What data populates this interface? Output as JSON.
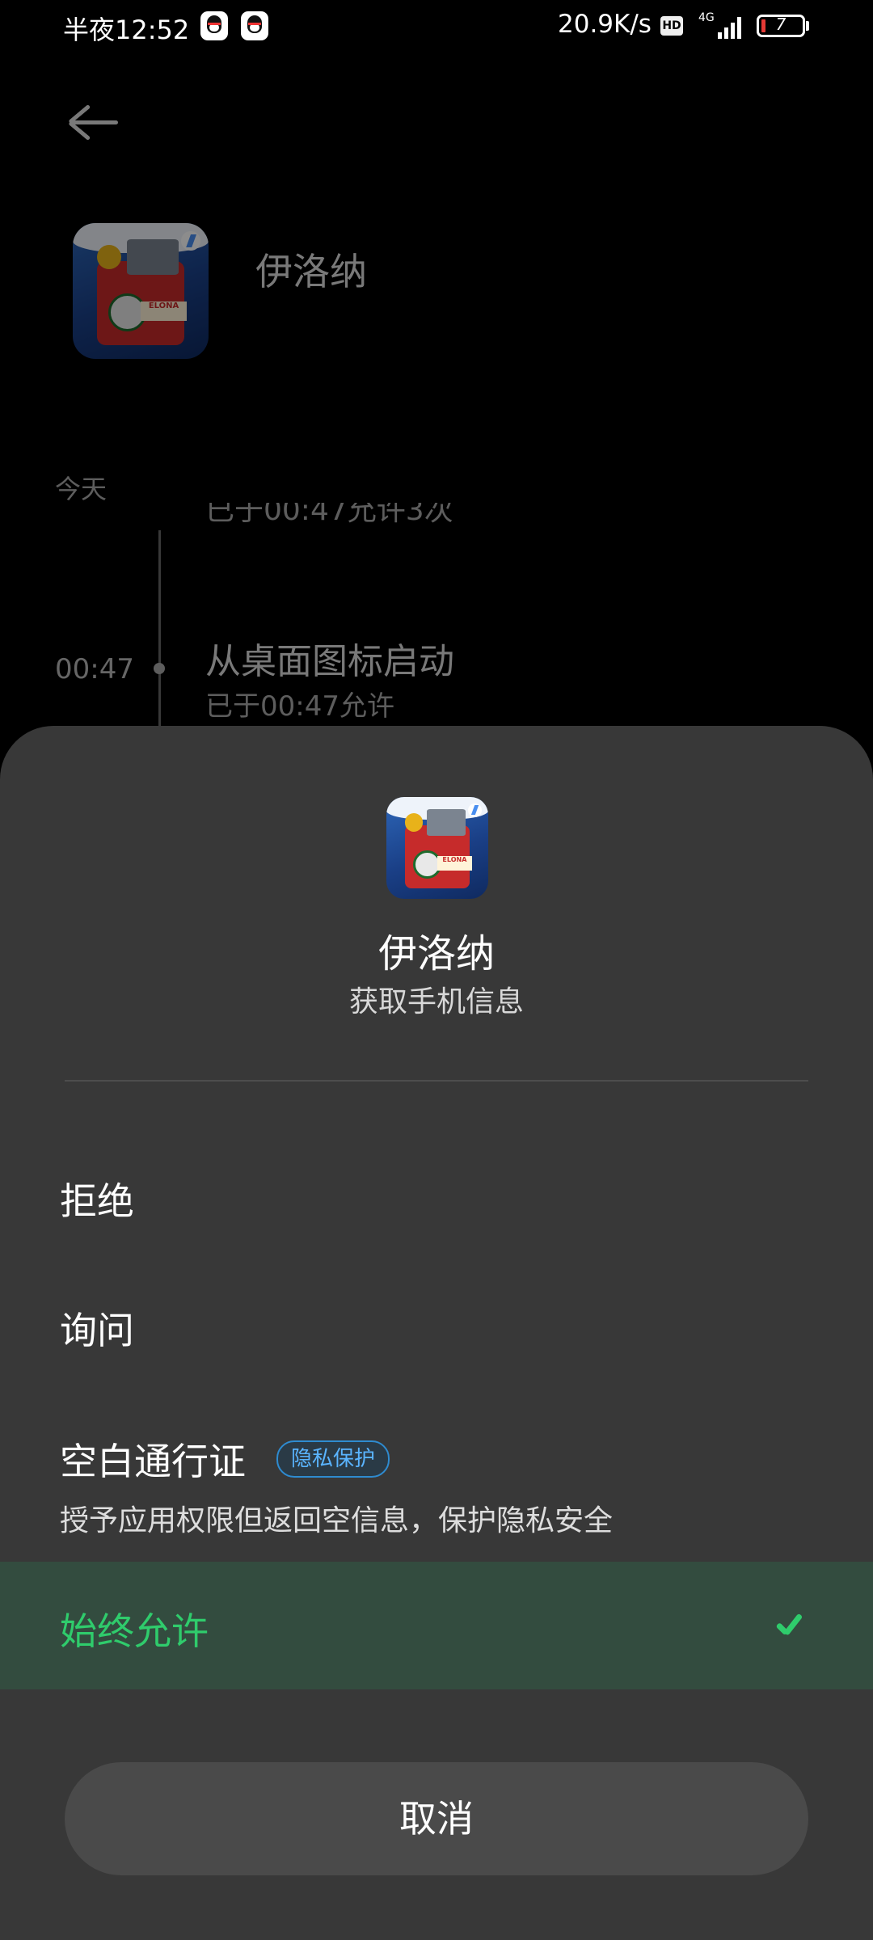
{
  "status_bar": {
    "time": "半夜12:52",
    "net_speed": "20.9K/s",
    "hd": "HD",
    "network": "4G",
    "battery": "7"
  },
  "background": {
    "app_name": "伊洛纳",
    "section_label": "今天",
    "partial_text": "已于00:47允许3次",
    "log_time": "00:47",
    "log_title": "从桌面图标启动",
    "log_subtitle": "已于00:47允许"
  },
  "sheet": {
    "app_name": "伊洛纳",
    "permission": "获取手机信息",
    "icon_label": "ELONA",
    "options": [
      {
        "label": "拒绝"
      },
      {
        "label": "询问"
      },
      {
        "label": "空白通行证",
        "badge": "隐私保护",
        "description": "授予应用权限但返回空信息，保护隐私安全"
      },
      {
        "label": "始终允许",
        "selected": true
      }
    ],
    "cancel_label": "取消"
  },
  "colors": {
    "selected_bg": "#334c3f",
    "selected_text": "#2fcc6c",
    "sheet_bg": "#383838",
    "badge_text": "#5ab4ff"
  }
}
